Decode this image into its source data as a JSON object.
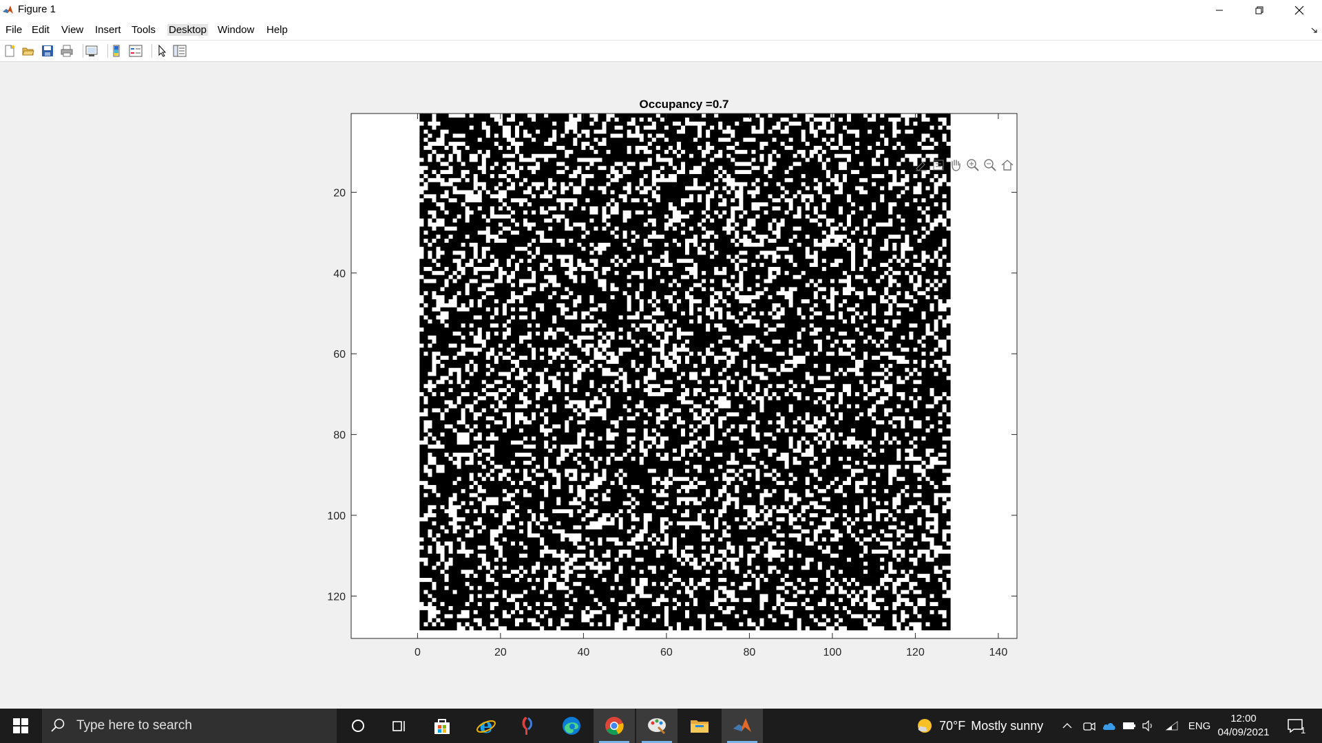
{
  "window": {
    "title": "Figure 1"
  },
  "menu": [
    "File",
    "Edit",
    "View",
    "Insert",
    "Tools",
    "Desktop",
    "Window",
    "Help"
  ],
  "toolbar": {
    "icons": [
      "new-figure-icon",
      "open-file-icon",
      "save-icon",
      "print-icon",
      "link-plot-icon",
      "insert-colorbar-icon",
      "insert-legend-icon",
      "edit-plot-icon",
      "open-property-inspector-icon"
    ]
  },
  "axes_toolbar": {
    "icons": [
      "brush-icon",
      "data-tips-icon",
      "pan-hand-icon",
      "zoom-in-icon",
      "zoom-out-icon",
      "restore-view-icon"
    ]
  },
  "chart_data": {
    "type": "heatmap",
    "title": "Occupancy =0.7",
    "xlabel": "",
    "ylabel": "",
    "grid_size": [
      128,
      128
    ],
    "occupancy": 0.7,
    "colormap": {
      "occupied": "#000000",
      "empty": "#ffffff"
    },
    "xlim": [
      -16,
      144.5
    ],
    "ylim": [
      0.5,
      130.5
    ],
    "y_reversed": true,
    "xticks": [
      0,
      20,
      40,
      60,
      80,
      100,
      120,
      140
    ],
    "yticks": [
      20,
      40,
      60,
      80,
      100,
      120
    ],
    "grid": false,
    "box": true
  },
  "taskbar": {
    "search_placeholder": "Type here to search",
    "weather": {
      "temp": "70°F",
      "condition": "Mostly sunny"
    },
    "language": "ENG",
    "time": "12:00",
    "date": "04/09/2021",
    "notification_count": "1",
    "apps": [
      "cortana-icon",
      "task-view-icon",
      "microsoft-store-icon",
      "internet-explorer-icon",
      "app-icon",
      "edge-icon",
      "chrome-icon",
      "paint-icon",
      "file-explorer-icon",
      "matlab-icon"
    ]
  },
  "colors": {
    "taskbar_bg": "#1c1c1c",
    "accent": "#7ab4e6",
    "figure_bg": "#f0f0f0"
  }
}
